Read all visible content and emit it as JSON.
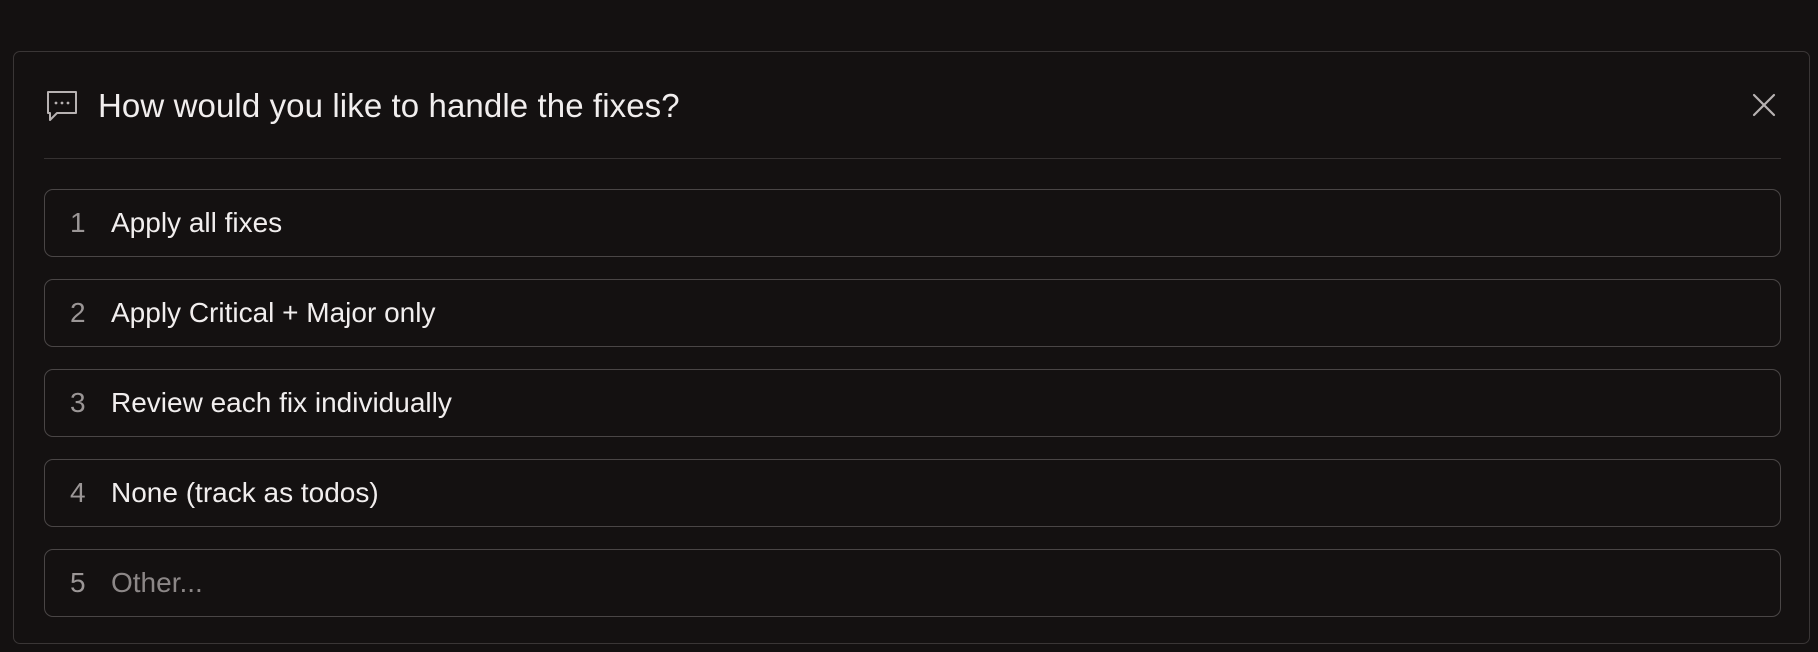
{
  "dialog": {
    "title": "How would you like to handle the fixes?",
    "icons": {
      "header": "chat-bubble-icon",
      "close": "close-icon"
    },
    "options": [
      {
        "number": "1",
        "label": "Apply all fixes"
      },
      {
        "number": "2",
        "label": "Apply Critical + Major only"
      },
      {
        "number": "3",
        "label": "Review each fix individually"
      },
      {
        "number": "4",
        "label": "None (track as todos)"
      },
      {
        "number": "5",
        "label": "Other..."
      }
    ]
  },
  "colors": {
    "background": "#141111",
    "panel_border": "#3a3636",
    "option_border": "#4a4646",
    "text": "#f1eeee",
    "muted_text": "#8c8787"
  }
}
